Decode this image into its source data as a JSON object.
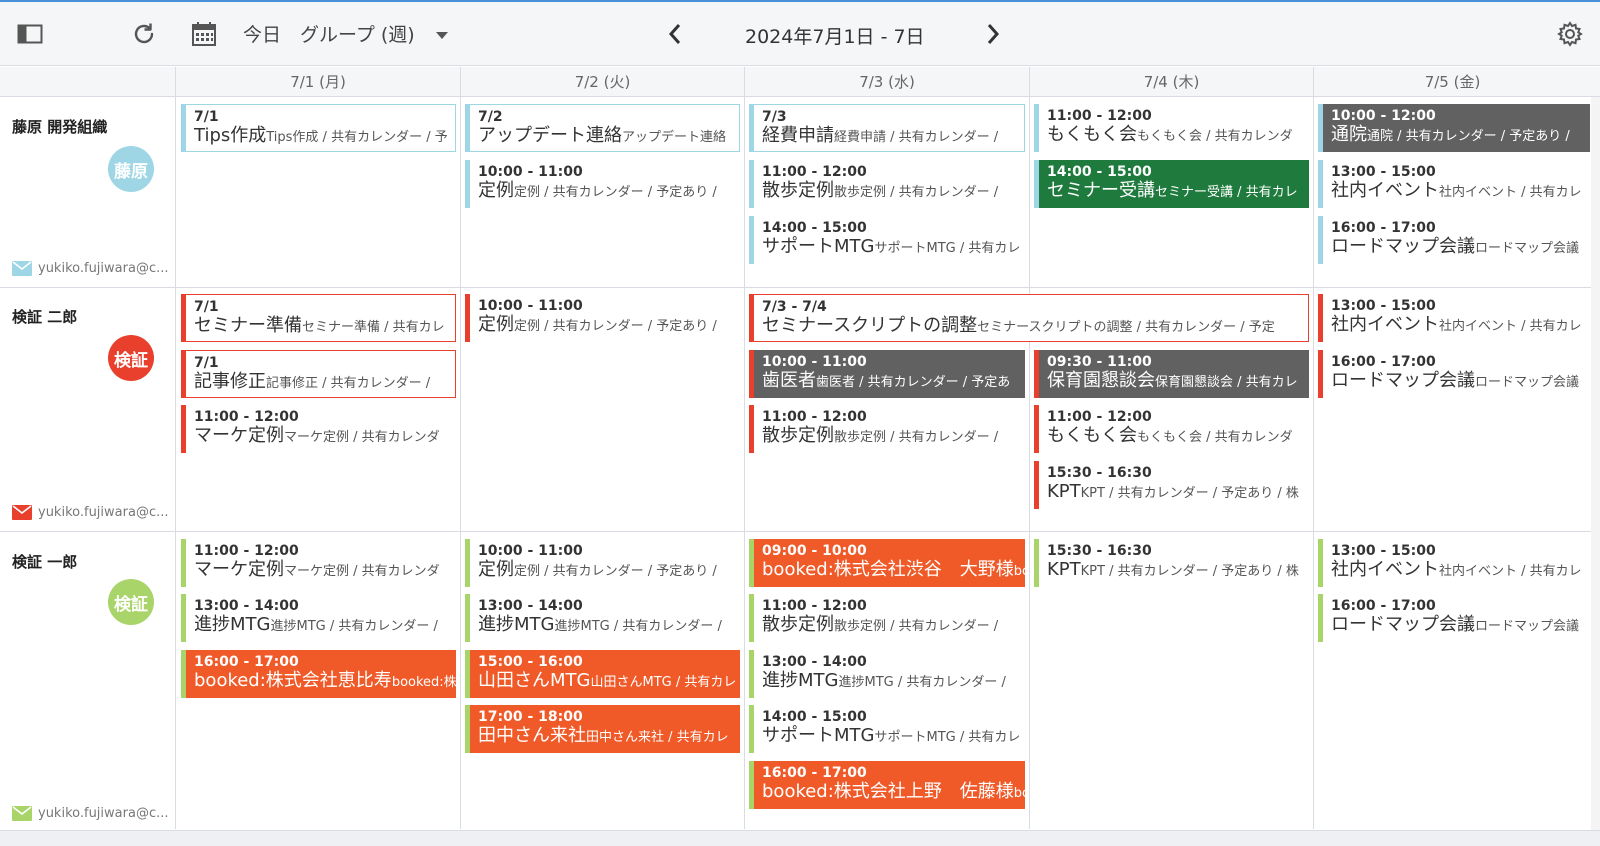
{
  "toolbar": {
    "today_label": "今日",
    "view_label": "グループ (週)",
    "range_label": "2024年7月1日 - 7日",
    "icons": [
      "sidebar-toggle-icon",
      "refresh-icon",
      "calendar-icon",
      "chevron-down-icon",
      "chevron-left-icon",
      "chevron-right-icon",
      "gear-icon"
    ]
  },
  "days": [
    "7/1 (月)",
    "7/2 (火)",
    "7/3 (水)",
    "7/4 (木)",
    "7/5 (金)"
  ],
  "colors": {
    "fujiwara": "#9ed6e6",
    "jiro": "#e8402d",
    "ichiro": "#a8d46a",
    "gray_event": "#616161",
    "green_event": "#1e7b3d",
    "orange_event": "#f05a28"
  },
  "members": [
    {
      "name": "藤原 開発組織",
      "avatar": "藤原",
      "email": "yukiko.fujiwara@c..."
    },
    {
      "name": "検証 二郎",
      "avatar": "検証",
      "email": "yukiko.fujiwara@c..."
    },
    {
      "name": "検証 一郎",
      "avatar": "検証",
      "email": "yukiko.fujiwara@c..."
    }
  ],
  "events": {
    "r0d0a": {
      "time": "7/1",
      "title": "Tips作成",
      "detail": "Tips作成 / 共有カレンダー / 予"
    },
    "r0d1a": {
      "time": "7/2",
      "title": "アップデート連絡",
      "detail": "アップデート連絡"
    },
    "r0d1b": {
      "time": "10:00 - 11:00",
      "title": "定例",
      "detail": "定例 / 共有カレンダー / 予定あり /"
    },
    "r0d2a": {
      "time": "7/3",
      "title": "経費申請",
      "detail": "経費申請 / 共有カレンダー /"
    },
    "r0d2b": {
      "time": "11:00 - 12:00",
      "title": "散歩定例",
      "detail": "散歩定例 / 共有カレンダー /"
    },
    "r0d2c": {
      "time": "14:00 - 15:00",
      "title": "サポートMTG",
      "detail": "サポートMTG / 共有カレ"
    },
    "r0d3a": {
      "time": "11:00 - 12:00",
      "title": "もくもく会",
      "detail": "もくもく会 / 共有カレンダ"
    },
    "r0d3b": {
      "time": "14:00 - 15:00",
      "title": "セミナー受講",
      "detail": "セミナー受講 / 共有カレ"
    },
    "r0d4a": {
      "time": "10:00 - 12:00",
      "title": "通院",
      "detail": "通院 / 共有カレンダー / 予定あり /"
    },
    "r0d4b": {
      "time": "13:00 - 15:00",
      "title": "社内イベント",
      "detail": "社内イベント / 共有カレ"
    },
    "r0d4c": {
      "time": "16:00 - 17:00",
      "title": "ロードマップ会議",
      "detail": "ロードマップ会議"
    },
    "r1d0a": {
      "time": "7/1",
      "title": "セミナー準備",
      "detail": "セミナー準備 / 共有カレ"
    },
    "r1d0b": {
      "time": "7/1",
      "title": "記事修正",
      "detail": "記事修正 / 共有カレンダー /"
    },
    "r1d0c": {
      "time": "11:00 - 12:00",
      "title": "マーケ定例",
      "detail": "マーケ定例 / 共有カレンダ"
    },
    "r1d1a": {
      "time": "10:00 - 11:00",
      "title": "定例",
      "detail": "定例 / 共有カレンダー / 予定あり /"
    },
    "r1d2span": {
      "time": "7/3 - 7/4",
      "title": "セミナースクリプトの調整",
      "detail": "セミナースクリプトの調整 / 共有カレンダー / 予定"
    },
    "r1d2a": {
      "time": "10:00 - 11:00",
      "title": "歯医者",
      "detail": "歯医者 / 共有カレンダー / 予定あ"
    },
    "r1d2b": {
      "time": "11:00 - 12:00",
      "title": "散歩定例",
      "detail": "散歩定例 / 共有カレンダー /"
    },
    "r1d3a": {
      "time": "09:30 - 11:00",
      "title": "保育園懇談会",
      "detail": "保育園懇談会 / 共有カレ"
    },
    "r1d3b": {
      "time": "11:00 - 12:00",
      "title": "もくもく会",
      "detail": "もくもく会 / 共有カレンダ"
    },
    "r1d3c": {
      "time": "15:30 - 16:30",
      "title": "KPT",
      "detail": "KPT / 共有カレンダー / 予定あり / 株"
    },
    "r1d4a": {
      "time": "13:00 - 15:00",
      "title": "社内イベント",
      "detail": "社内イベント / 共有カレ"
    },
    "r1d4b": {
      "time": "16:00 - 17:00",
      "title": "ロードマップ会議",
      "detail": "ロードマップ会議"
    },
    "r2d0a": {
      "time": "11:00 - 12:00",
      "title": "マーケ定例",
      "detail": "マーケ定例 / 共有カレンダ"
    },
    "r2d0b": {
      "time": "13:00 - 14:00",
      "title": "進捗MTG",
      "detail": "進捗MTG / 共有カレンダー /"
    },
    "r2d0c": {
      "time": "16:00 - 17:00",
      "title": "booked:株式会社恵比寿",
      "detail": "booked:株"
    },
    "r2d1a": {
      "time": "10:00 - 11:00",
      "title": "定例",
      "detail": "定例 / 共有カレンダー / 予定あり /"
    },
    "r2d1b": {
      "time": "13:00 - 14:00",
      "title": "進捗MTG",
      "detail": "進捗MTG / 共有カレンダー /"
    },
    "r2d1c": {
      "time": "15:00 - 16:00",
      "title": "山田さんMTG",
      "detail": "山田さんMTG / 共有カレ"
    },
    "r2d1d": {
      "time": "17:00 - 18:00",
      "title": "田中さん来社",
      "detail": "田中さん来社 / 共有カレ"
    },
    "r2d2a": {
      "time": "09:00 - 10:00",
      "title": "booked:株式会社渋谷　大野様",
      "detail": "bo"
    },
    "r2d2b": {
      "time": "11:00 - 12:00",
      "title": "散歩定例",
      "detail": "散歩定例 / 共有カレンダー /"
    },
    "r2d2c": {
      "time": "13:00 - 14:00",
      "title": "進捗MTG",
      "detail": "進捗MTG / 共有カレンダー /"
    },
    "r2d2d": {
      "time": "14:00 - 15:00",
      "title": "サポートMTG",
      "detail": "サポートMTG / 共有カレ"
    },
    "r2d2e": {
      "time": "16:00 - 17:00",
      "title": "booked:株式会社上野　佐藤様",
      "detail": "bo"
    },
    "r2d3a": {
      "time": "15:30 - 16:30",
      "title": "KPT",
      "detail": "KPT / 共有カレンダー / 予定あり / 株"
    },
    "r2d4a": {
      "time": "13:00 - 15:00",
      "title": "社内イベント",
      "detail": "社内イベント / 共有カレ"
    },
    "r2d4b": {
      "time": "16:00 - 17:00",
      "title": "ロードマップ会議",
      "detail": "ロードマップ会議"
    }
  }
}
